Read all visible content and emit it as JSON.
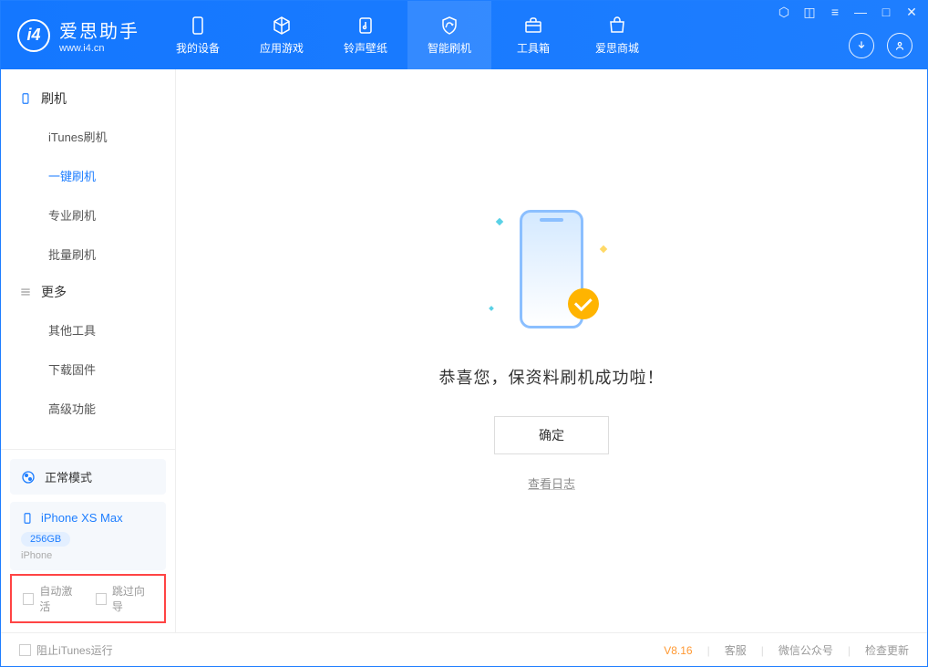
{
  "app": {
    "name": "爱思助手",
    "url": "www.i4.cn"
  },
  "nav": {
    "tabs": [
      {
        "label": "我的设备"
      },
      {
        "label": "应用游戏"
      },
      {
        "label": "铃声壁纸"
      },
      {
        "label": "智能刷机"
      },
      {
        "label": "工具箱"
      },
      {
        "label": "爱思商城"
      }
    ]
  },
  "sidebar": {
    "section1": {
      "title": "刷机"
    },
    "items1": [
      {
        "label": "iTunes刷机"
      },
      {
        "label": "一键刷机"
      },
      {
        "label": "专业刷机"
      },
      {
        "label": "批量刷机"
      }
    ],
    "section2": {
      "title": "更多"
    },
    "items2": [
      {
        "label": "其他工具"
      },
      {
        "label": "下载固件"
      },
      {
        "label": "高级功能"
      }
    ]
  },
  "device": {
    "mode": "正常模式",
    "name": "iPhone XS Max",
    "storage": "256GB",
    "type": "iPhone"
  },
  "options": {
    "auto_activate": "自动激活",
    "skip_guide": "跳过向导"
  },
  "main": {
    "success_message": "恭喜您，保资料刷机成功啦！",
    "confirm": "确定",
    "view_log": "查看日志"
  },
  "footer": {
    "block_itunes": "阻止iTunes运行",
    "version": "V8.16",
    "support": "客服",
    "wechat": "微信公众号",
    "check_update": "检查更新"
  }
}
